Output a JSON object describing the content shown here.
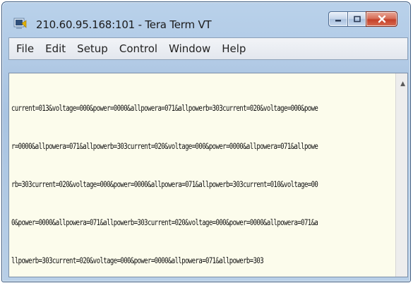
{
  "window": {
    "title": "210.60.95.168:101 - Tera Term VT",
    "icon": "tera-term-app-icon",
    "buttons": {
      "minimize": "minimize-icon",
      "maximize": "maximize-icon",
      "close": "close-icon"
    }
  },
  "menu": {
    "items": [
      "File",
      "Edit",
      "Setup",
      "Control",
      "Window",
      "Help"
    ]
  },
  "terminal": {
    "lines": [
      "current=013&voltage=000&power=0000&allpowera=071&allpowerb=303current=020&voltage=000&powe",
      "r=0000&allpowera=071&allpowerb=303current=020&voltage=000&power=0000&allpowera=071&allpowe",
      "rb=303current=020&voltage=000&power=0000&allpowera=071&allpowerb=303current=010&voltage=00",
      "0&power=0000&allpowera=071&allpowerb=303current=020&voltage=000&power=0000&allpowera=071&a",
      "llpowerb=303current=020&voltage=000&power=0000&allpowera=071&allpowerb=303"
    ]
  },
  "colors": {
    "terminal_bg": "#fcfcec",
    "frame": "#b9d1ea",
    "close": "#c4412a"
  }
}
